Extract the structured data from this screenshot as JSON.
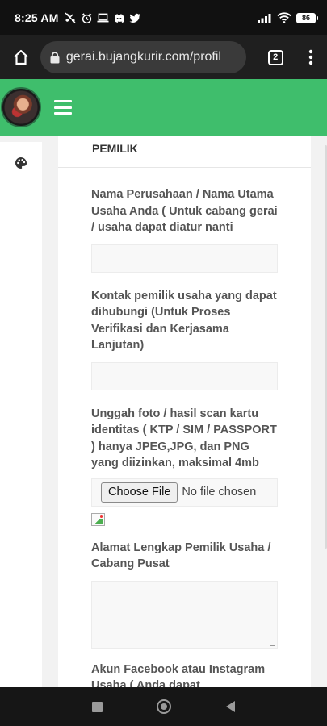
{
  "status_bar": {
    "time": "8:25 AM",
    "battery_level": "86",
    "icons": [
      "missed-call-icon",
      "alarm-icon",
      "laptop-icon",
      "discord-icon",
      "twitter-icon",
      "signal-icon",
      "wifi-icon",
      "battery-icon"
    ]
  },
  "browser": {
    "url": "gerai.bujangkurir.com/profil",
    "tab_count": "2"
  },
  "card": {
    "section_title": "PEMILIK",
    "fields": [
      {
        "label": "Nama Perusahaan / Nama Utama Usaha Anda ( Untuk cabang gerai / usaha dapat diatur nanti",
        "value": ""
      },
      {
        "label": "Kontak pemilik usaha yang dapat dihubungi (Untuk Proses Verifikasi dan Kerjasama Lanjutan)",
        "value": ""
      },
      {
        "label": "Unggah foto / hasil scan kartu identitas ( KTP / SIM / PASSPORT ) hanya JPEG,JPG, dan PNG yang diizinkan, maksimal 4mb",
        "button": "Choose File",
        "status": "No file chosen"
      },
      {
        "label": "Alamat Lengkap Pemilik Usaha / Cabang Pusat",
        "value": ""
      },
      {
        "label": "Akun Facebook atau Instagram Usaha ( Anda dapat mengosongkan ini )",
        "value": ""
      }
    ]
  },
  "colors": {
    "header_green": "#3fbe6c",
    "browser_bar": "#1f1f1f"
  }
}
